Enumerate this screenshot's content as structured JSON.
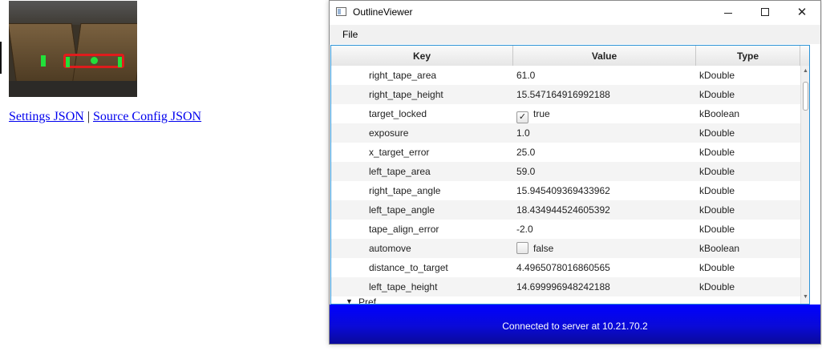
{
  "links": {
    "settings": "Settings JSON",
    "separator": "|",
    "source_config": "Source Config JSON"
  },
  "window": {
    "title": "OutlineViewer",
    "controls": {
      "minimize": "minimize-icon",
      "maximize": "maximize-icon",
      "close": "✕"
    }
  },
  "menu": {
    "file": "File"
  },
  "table": {
    "headers": {
      "key": "Key",
      "value": "Value",
      "type": "Type"
    },
    "rows": [
      {
        "key": "right_tape_area",
        "value": "61.0",
        "type": "kDouble"
      },
      {
        "key": "right_tape_height",
        "value": "15.547164916992188",
        "type": "kDouble"
      },
      {
        "key": "target_locked",
        "value": "true",
        "type": "kBoolean",
        "checked": "✓"
      },
      {
        "key": "exposure",
        "value": "1.0",
        "type": "kDouble"
      },
      {
        "key": "x_target_error",
        "value": "25.0",
        "type": "kDouble"
      },
      {
        "key": "left_tape_area",
        "value": "59.0",
        "type": "kDouble"
      },
      {
        "key": "right_tape_angle",
        "value": "15.945409369433962",
        "type": "kDouble"
      },
      {
        "key": "left_tape_angle",
        "value": "18.434944524605392",
        "type": "kDouble"
      },
      {
        "key": "tape_align_error",
        "value": "-2.0",
        "type": "kDouble"
      },
      {
        "key": "automove",
        "value": "false",
        "type": "kBoolean",
        "checked": ""
      },
      {
        "key": "distance_to_target",
        "value": "4.4965078016860565",
        "type": "kDouble"
      },
      {
        "key": "left_tape_height",
        "value": "14.699996948242188",
        "type": "kDouble"
      }
    ],
    "partial_row": {
      "arrow": "▼",
      "key": "Pref"
    }
  },
  "status": {
    "text": "Connected to server at 10.21.70.2"
  },
  "colors": {
    "status_bar": "#0000ff",
    "selection_border": "#2d93d6",
    "target_box": "#e01c1c",
    "tape": "#22e03a"
  }
}
